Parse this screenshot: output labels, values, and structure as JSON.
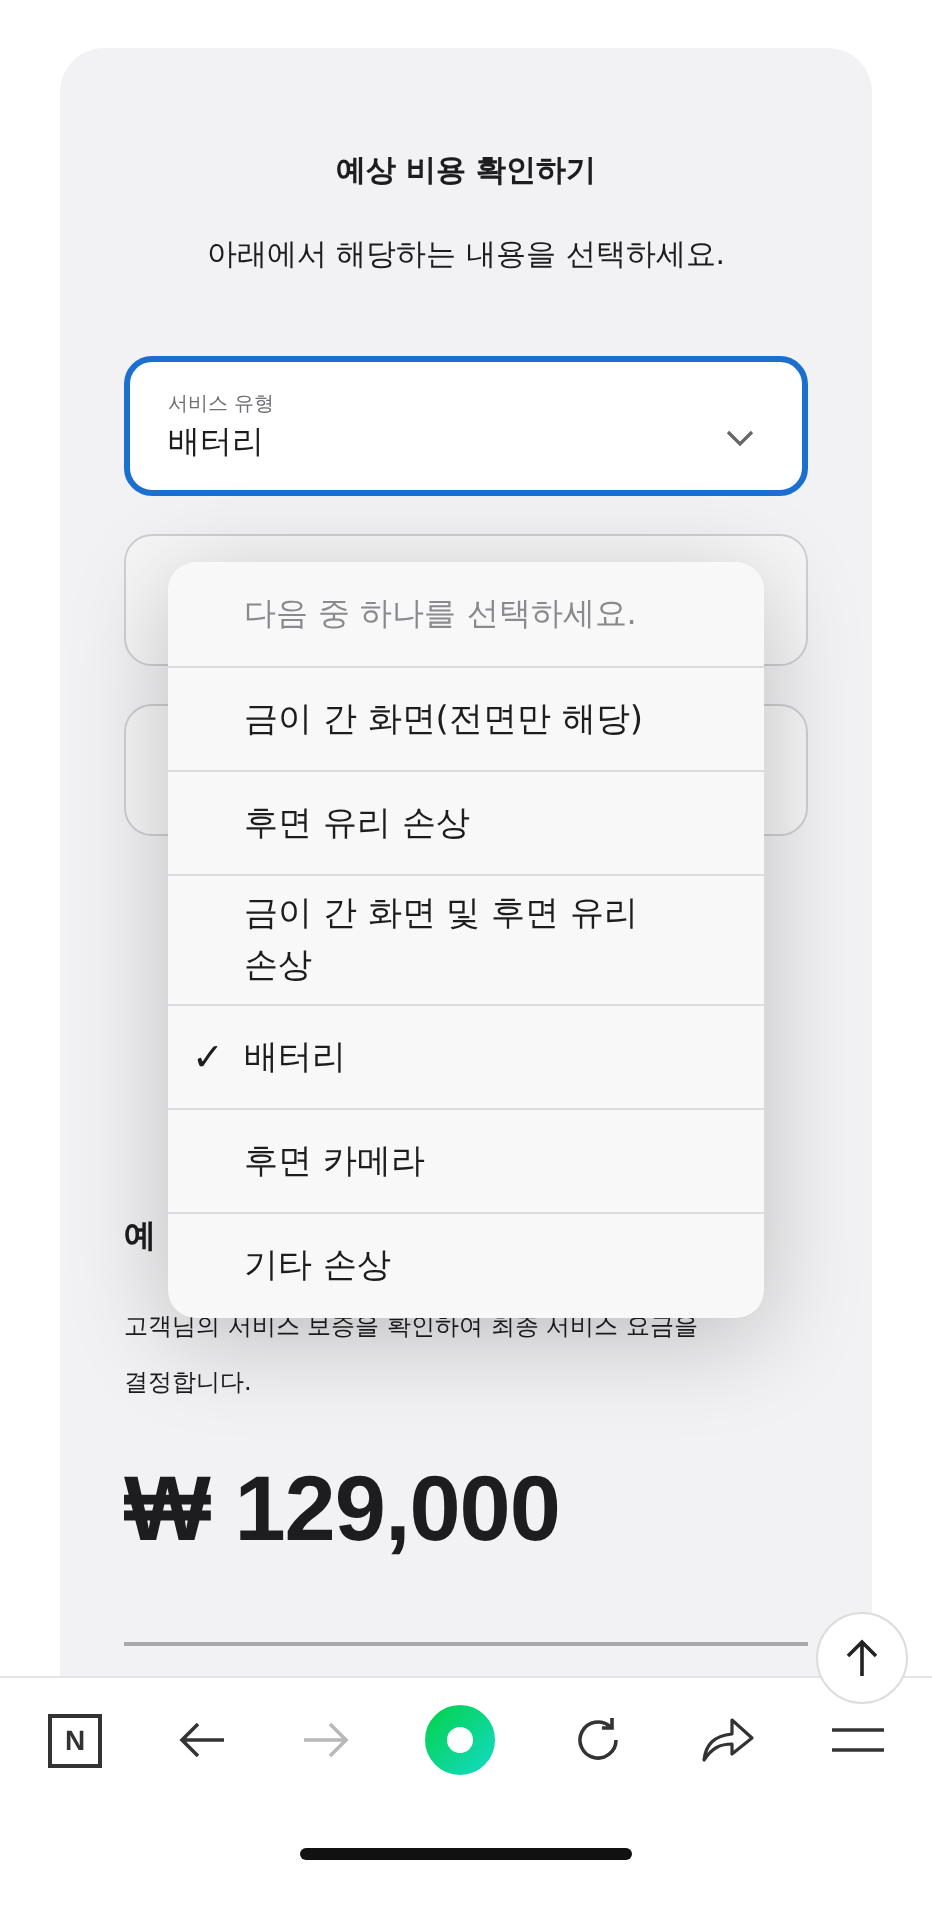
{
  "card": {
    "title": "예상 비용 확인하기",
    "subtitle": "아래에서 해당하는 내용을 선택하세요.",
    "service_field": {
      "label": "서비스 유형",
      "value": "배터리",
      "focused": true
    },
    "covered_fields": [
      {
        "kind": "select"
      },
      {
        "kind": "select"
      }
    ],
    "dropdown": {
      "placeholder": "다음 중 하나를 선택하세요.",
      "options": [
        {
          "label": "금이 간 화면(전면만 해당)",
          "selected": false
        },
        {
          "label": "후면 유리 손상",
          "selected": false
        },
        {
          "label": "금이 간 화면 및 후면 유리 손상",
          "selected": false
        },
        {
          "label": "배터리",
          "selected": true
        },
        {
          "label": "후면 카메라",
          "selected": false
        },
        {
          "label": "기타 손상",
          "selected": false
        }
      ],
      "check_mark": "✓"
    },
    "estimate": {
      "heading": "예",
      "description": "고객님의 서비스 보증을 확인하여 최종 서비스 요금을 결정합니다.",
      "price": "₩ 129,000"
    }
  },
  "toolbar": [
    {
      "kind": "logo",
      "label": "N",
      "disabled": false
    },
    {
      "kind": "back",
      "disabled": false
    },
    {
      "kind": "forward",
      "disabled": true
    },
    {
      "kind": "home",
      "disabled": false
    },
    {
      "kind": "reload",
      "disabled": false
    },
    {
      "kind": "share",
      "disabled": false
    },
    {
      "kind": "menu",
      "disabled": false
    }
  ]
}
